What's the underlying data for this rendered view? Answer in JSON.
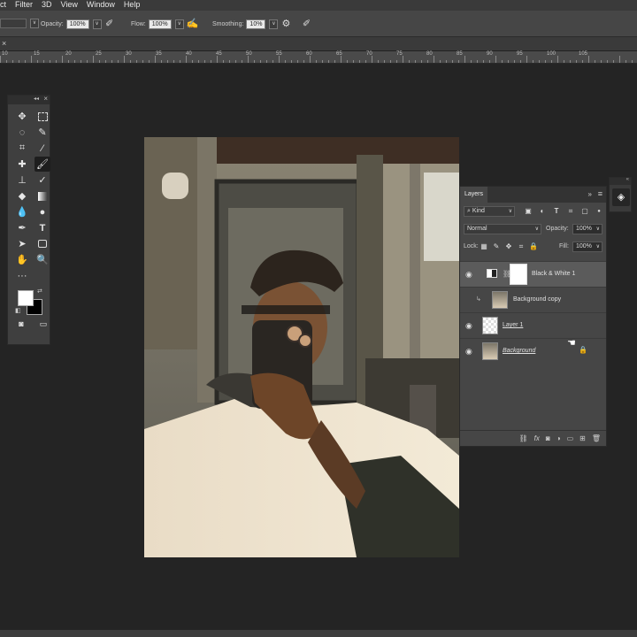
{
  "menubar": {
    "items": [
      "ct",
      "Filter",
      "3D",
      "View",
      "Window",
      "Help"
    ]
  },
  "options": {
    "opacity_label": "Opacity:",
    "opacity_value": "100%",
    "flow_label": "Flow:",
    "flow_value": "100%",
    "smoothing_label": "Smoothing:",
    "smoothing_value": "10%"
  },
  "ruler": {
    "ticks": [
      "10",
      "15",
      "20",
      "25",
      "30",
      "35",
      "40",
      "45",
      "50",
      "55",
      "60",
      "65",
      "70",
      "75",
      "80",
      "85",
      "90",
      "95",
      "100",
      "105"
    ]
  },
  "layers": {
    "tab_label": "Layers",
    "filter_kind": "Kind",
    "blend_mode": "Normal",
    "opacity_label": "Opacity:",
    "opacity_value": "100%",
    "lock_label": "Lock:",
    "fill_label": "Fill:",
    "fill_value": "100%",
    "items": [
      {
        "name": "Black & White 1"
      },
      {
        "name": "Background copy"
      },
      {
        "name": "Layer 1"
      },
      {
        "name": "Background"
      }
    ],
    "footer_fx": "fx"
  },
  "colors": {
    "foreground": "#ffffff",
    "background": "#000000",
    "selected_layer": "#5b5b5b"
  }
}
